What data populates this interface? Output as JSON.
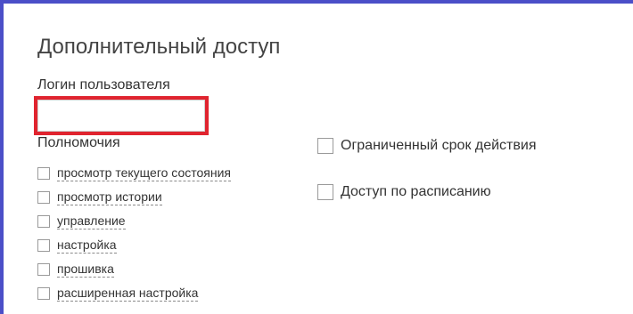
{
  "panel": {
    "title": "Дополнительный доступ",
    "login_label": "Логин пользователя",
    "login_value": "",
    "permissions_title": "Полномочия"
  },
  "permissions": [
    {
      "label": "просмотр текущего состояния",
      "checked": false
    },
    {
      "label": "просмотр истории",
      "checked": false
    },
    {
      "label": "управление",
      "checked": false
    },
    {
      "label": "настройка",
      "checked": false
    },
    {
      "label": "прошивка",
      "checked": false
    },
    {
      "label": "расширенная настройка",
      "checked": false
    }
  ],
  "options": [
    {
      "label": "Ограниченный срок действия",
      "checked": false
    },
    {
      "label": "Доступ по расписанию",
      "checked": false
    }
  ],
  "colors": {
    "frame_accent": "#4b4fc8",
    "highlight": "#e0242f"
  }
}
